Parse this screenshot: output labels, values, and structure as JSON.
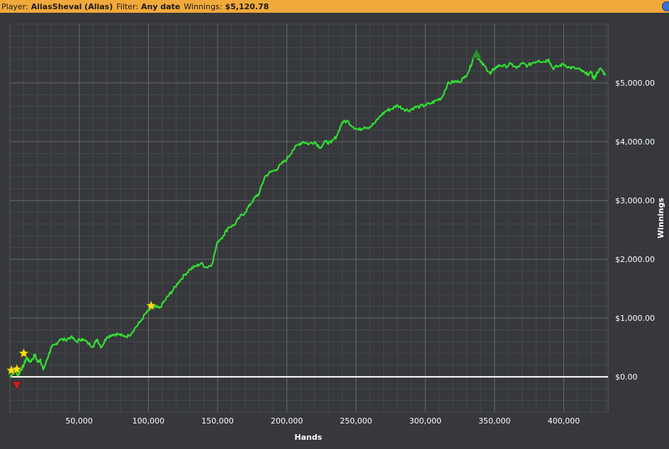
{
  "header": {
    "player_label": "Player:",
    "player_value": "AliasSheval (Alias)",
    "filter_label": "Filter:",
    "filter_value": "Any date",
    "winnings_label": "Winnings:",
    "winnings_value": "$5,120.78"
  },
  "colors": {
    "header_bg": "#f2a93b",
    "plot_bg": "#36383b",
    "line": "#33dd33",
    "zero_line": "#ffffff",
    "grid": "#55585c",
    "star": "#f4e21b",
    "max_marker": "#2f8c2f",
    "min_marker": "#cc2222"
  },
  "chart_data": {
    "type": "line",
    "xlabel": "Hands",
    "ylabel": "Winnings",
    "xlim": [
      0,
      432000
    ],
    "ylim": [
      -600,
      6000
    ],
    "x_ticks": [
      50000,
      100000,
      150000,
      200000,
      250000,
      300000,
      350000,
      400000
    ],
    "x_tick_labels": [
      "50,000",
      "100,000",
      "150,000",
      "200,000",
      "250,000",
      "300,000",
      "350,000",
      "400,000"
    ],
    "y_ticks": [
      0,
      1000,
      2000,
      3000,
      4000,
      5000
    ],
    "y_tick_labels": [
      "$0.00",
      "$1,000.00",
      "$2,000.00",
      "$3,000.00",
      "$4,000.00",
      "$5,000.00"
    ],
    "grid": true,
    "series": [
      {
        "points": [
          [
            0,
            0
          ],
          [
            2000,
            60
          ],
          [
            4000,
            100
          ],
          [
            6000,
            30
          ],
          [
            8000,
            120
          ],
          [
            10000,
            200
          ],
          [
            12000,
            330
          ],
          [
            14000,
            260
          ],
          [
            16000,
            290
          ],
          [
            18000,
            380
          ],
          [
            20000,
            250
          ],
          [
            22000,
            300
          ],
          [
            24000,
            120
          ],
          [
            26000,
            240
          ],
          [
            28000,
            380
          ],
          [
            30000,
            500
          ],
          [
            33000,
            550
          ],
          [
            36000,
            640
          ],
          [
            40000,
            630
          ],
          [
            44000,
            680
          ],
          [
            48000,
            600
          ],
          [
            52000,
            650
          ],
          [
            56000,
            580
          ],
          [
            60000,
            520
          ],
          [
            63000,
            640
          ],
          [
            66000,
            500
          ],
          [
            70000,
            680
          ],
          [
            74000,
            720
          ],
          [
            78000,
            730
          ],
          [
            82000,
            690
          ],
          [
            86000,
            700
          ],
          [
            90000,
            820
          ],
          [
            94000,
            930
          ],
          [
            98000,
            1080
          ],
          [
            102000,
            1160
          ],
          [
            105000,
            1190
          ],
          [
            108000,
            1170
          ],
          [
            112000,
            1300
          ],
          [
            115000,
            1400
          ],
          [
            118000,
            1480
          ],
          [
            122000,
            1620
          ],
          [
            126000,
            1730
          ],
          [
            130000,
            1830
          ],
          [
            134000,
            1880
          ],
          [
            138000,
            1930
          ],
          [
            142000,
            1860
          ],
          [
            146000,
            1920
          ],
          [
            150000,
            2300
          ],
          [
            154000,
            2400
          ],
          [
            158000,
            2550
          ],
          [
            162000,
            2580
          ],
          [
            166000,
            2720
          ],
          [
            170000,
            2800
          ],
          [
            174000,
            2950
          ],
          [
            177000,
            3050
          ],
          [
            180000,
            3120
          ],
          [
            184000,
            3400
          ],
          [
            188000,
            3480
          ],
          [
            192000,
            3520
          ],
          [
            196000,
            3620
          ],
          [
            200000,
            3700
          ],
          [
            204000,
            3850
          ],
          [
            208000,
            3950
          ],
          [
            212000,
            4000
          ],
          [
            216000,
            3960
          ],
          [
            220000,
            4000
          ],
          [
            224000,
            3900
          ],
          [
            228000,
            4000
          ],
          [
            232000,
            3980
          ],
          [
            236000,
            4100
          ],
          [
            240000,
            4330
          ],
          [
            244000,
            4350
          ],
          [
            248000,
            4250
          ],
          [
            252000,
            4200
          ],
          [
            256000,
            4250
          ],
          [
            260000,
            4250
          ],
          [
            264000,
            4330
          ],
          [
            268000,
            4450
          ],
          [
            272000,
            4530
          ],
          [
            276000,
            4560
          ],
          [
            280000,
            4620
          ],
          [
            284000,
            4560
          ],
          [
            288000,
            4530
          ],
          [
            292000,
            4580
          ],
          [
            296000,
            4600
          ],
          [
            300000,
            4620
          ],
          [
            304000,
            4650
          ],
          [
            308000,
            4700
          ],
          [
            312000,
            4750
          ],
          [
            316000,
            4980
          ],
          [
            320000,
            5020
          ],
          [
            324000,
            5020
          ],
          [
            328000,
            5080
          ],
          [
            332000,
            5230
          ],
          [
            335000,
            5450
          ],
          [
            337000,
            5470
          ],
          [
            340000,
            5350
          ],
          [
            344000,
            5250
          ],
          [
            347000,
            5150
          ],
          [
            350000,
            5250
          ],
          [
            354000,
            5300
          ],
          [
            358000,
            5280
          ],
          [
            362000,
            5320
          ],
          [
            366000,
            5250
          ],
          [
            370000,
            5330
          ],
          [
            374000,
            5290
          ],
          [
            378000,
            5350
          ],
          [
            382000,
            5380
          ],
          [
            386000,
            5360
          ],
          [
            389000,
            5400
          ],
          [
            392000,
            5250
          ],
          [
            396000,
            5280
          ],
          [
            400000,
            5320
          ],
          [
            404000,
            5260
          ],
          [
            408000,
            5250
          ],
          [
            412000,
            5220
          ],
          [
            416000,
            5150
          ],
          [
            420000,
            5170
          ],
          [
            422000,
            5060
          ],
          [
            424000,
            5180
          ],
          [
            427000,
            5240
          ],
          [
            430000,
            5130
          ]
        ]
      }
    ],
    "markers": [
      {
        "kind": "star",
        "x": 1000,
        "y": 110
      },
      {
        "kind": "star",
        "x": 5000,
        "y": 130
      },
      {
        "kind": "star",
        "x": 10000,
        "y": 400
      },
      {
        "kind": "star",
        "x": 102000,
        "y": 1210
      },
      {
        "kind": "max-triangle",
        "x": 337000,
        "y": 5470
      },
      {
        "kind": "min-triangle",
        "x": 5000,
        "y": -140
      }
    ]
  }
}
